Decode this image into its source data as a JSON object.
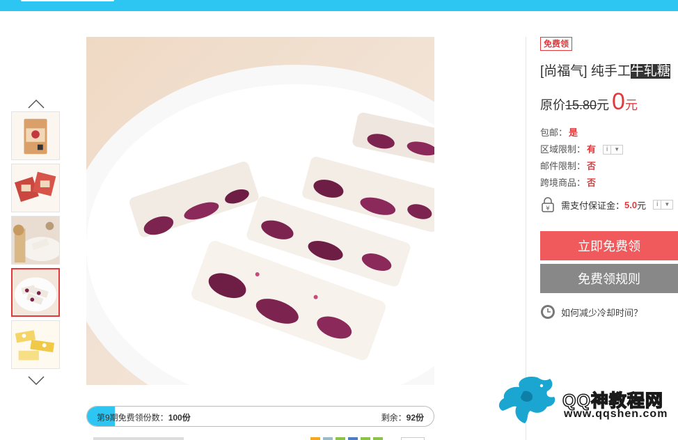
{
  "product": {
    "badge": "免费领",
    "title_prefix": "[尚福气] 纯手工",
    "title_highlight": "牛轧糖",
    "price_label": "原价",
    "original_price": "15.80",
    "original_unit": "元",
    "current_price": "0",
    "current_unit": "元"
  },
  "attributes": [
    {
      "key": "包邮：",
      "value": "是",
      "has_info": false
    },
    {
      "key": "区域限制：",
      "value": "有",
      "has_info": true
    },
    {
      "key": "邮件限制：",
      "value": "否",
      "has_info": false
    },
    {
      "key": "跨境商品：",
      "value": "否",
      "has_info": false
    }
  ],
  "info_icon": {
    "label": "i",
    "arrow": "▼"
  },
  "deposit": {
    "label": "需支付保证金：",
    "amount": "5.0",
    "unit": "元"
  },
  "buttons": {
    "claim": "立即免费领",
    "rules": "免费领规则"
  },
  "help": {
    "text": "如何减少冷却时间？"
  },
  "progress": {
    "label": "第9期免费领份数：",
    "total": "100份",
    "remaining_label": "剩余：",
    "remaining": "92份",
    "fraction_claimed": 0.08
  },
  "thumbnails": [
    {
      "name": "package-front",
      "active": false
    },
    {
      "name": "package-pair",
      "active": false
    },
    {
      "name": "candy-plate-side",
      "active": false
    },
    {
      "name": "candy-plate-purple",
      "active": true
    },
    {
      "name": "candy-yellow",
      "active": false
    }
  ],
  "watermark": {
    "title": "QQ神教程网",
    "url": "www.qqshen.com"
  },
  "colors": {
    "accent": "#e4393c",
    "topbar": "#2dc6f2",
    "claim_button": "#f05a5c",
    "rules_button": "#888888"
  }
}
